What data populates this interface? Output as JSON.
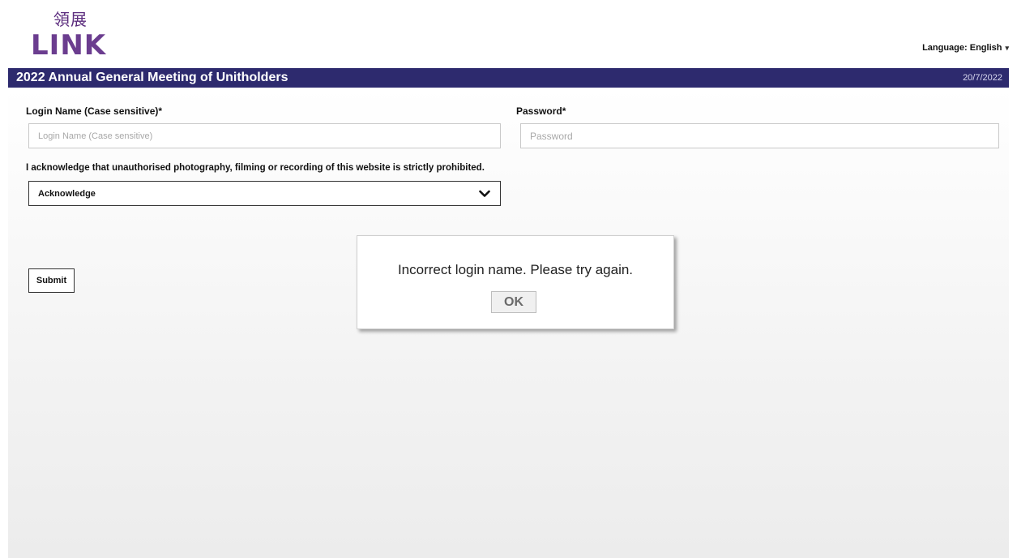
{
  "header": {
    "logo_cjk": "領展",
    "logo_word": "LINK",
    "language_label": "Language: English"
  },
  "titlebar": {
    "title": "2022 Annual General Meeting of Unitholders",
    "date": "20/7/2022"
  },
  "form": {
    "login_label": "Login Name (Case sensitive)*",
    "login_placeholder": "Login Name (Case sensitive)",
    "login_value": "",
    "password_label": "Password*",
    "password_placeholder": "Password",
    "password_value": "",
    "acknowledge_text": "I acknowledge that unauthorised photography, filming or recording of this website is strictly prohibited.",
    "acknowledge_selected": "Acknowledge",
    "submit_label": "Submit"
  },
  "dialog": {
    "message": "Incorrect login name. Please try again.",
    "ok_label": "OK"
  },
  "colors": {
    "titlebar_bg": "#2d2a6e",
    "brand_purple": "#6b3d8f"
  },
  "icons": {
    "language_caret": "caret-down-icon",
    "select_chevron": "chevron-down-icon"
  }
}
